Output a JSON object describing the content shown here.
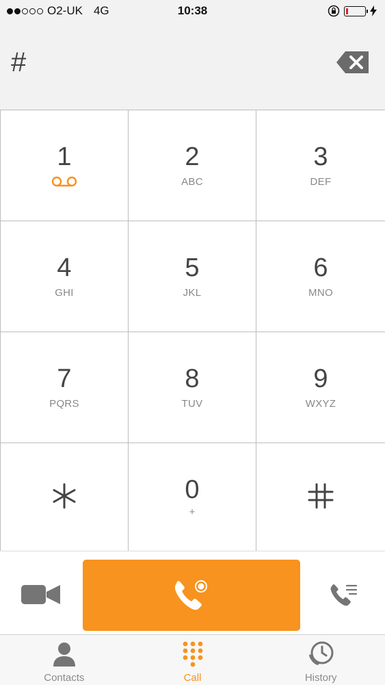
{
  "status_bar": {
    "carrier": "O2-UK",
    "network": "4G",
    "time": "10:38",
    "signal_bars_filled": 2,
    "signal_bars_total": 5,
    "battery_level": 0.1
  },
  "entry": {
    "value": "#"
  },
  "keypad": [
    {
      "digit": "1",
      "letters": "",
      "icon": "voicemail-icon"
    },
    {
      "digit": "2",
      "letters": "ABC"
    },
    {
      "digit": "3",
      "letters": "DEF"
    },
    {
      "digit": "4",
      "letters": "GHI"
    },
    {
      "digit": "5",
      "letters": "JKL"
    },
    {
      "digit": "6",
      "letters": "MNO"
    },
    {
      "digit": "7",
      "letters": "PQRS"
    },
    {
      "digit": "8",
      "letters": "TUV"
    },
    {
      "digit": "9",
      "letters": "WXYZ"
    },
    {
      "digit": "*",
      "letters": "",
      "icon": "asterisk-icon"
    },
    {
      "digit": "0",
      "letters": "+"
    },
    {
      "digit": "#",
      "letters": "",
      "icon": "hash-icon"
    }
  ],
  "actions": {
    "video_icon": "video-camera-icon",
    "call_icon": "phone-call-icon",
    "transfer_icon": "call-list-icon"
  },
  "tabs": [
    {
      "label": "Contacts",
      "icon": "contacts-icon",
      "active": false
    },
    {
      "label": "Call",
      "icon": "dialpad-icon",
      "active": true
    },
    {
      "label": "History",
      "icon": "history-icon",
      "active": false
    }
  ],
  "colors": {
    "accent": "#f7931e",
    "grey_icon": "#757575",
    "battery_low": "#e02424"
  }
}
